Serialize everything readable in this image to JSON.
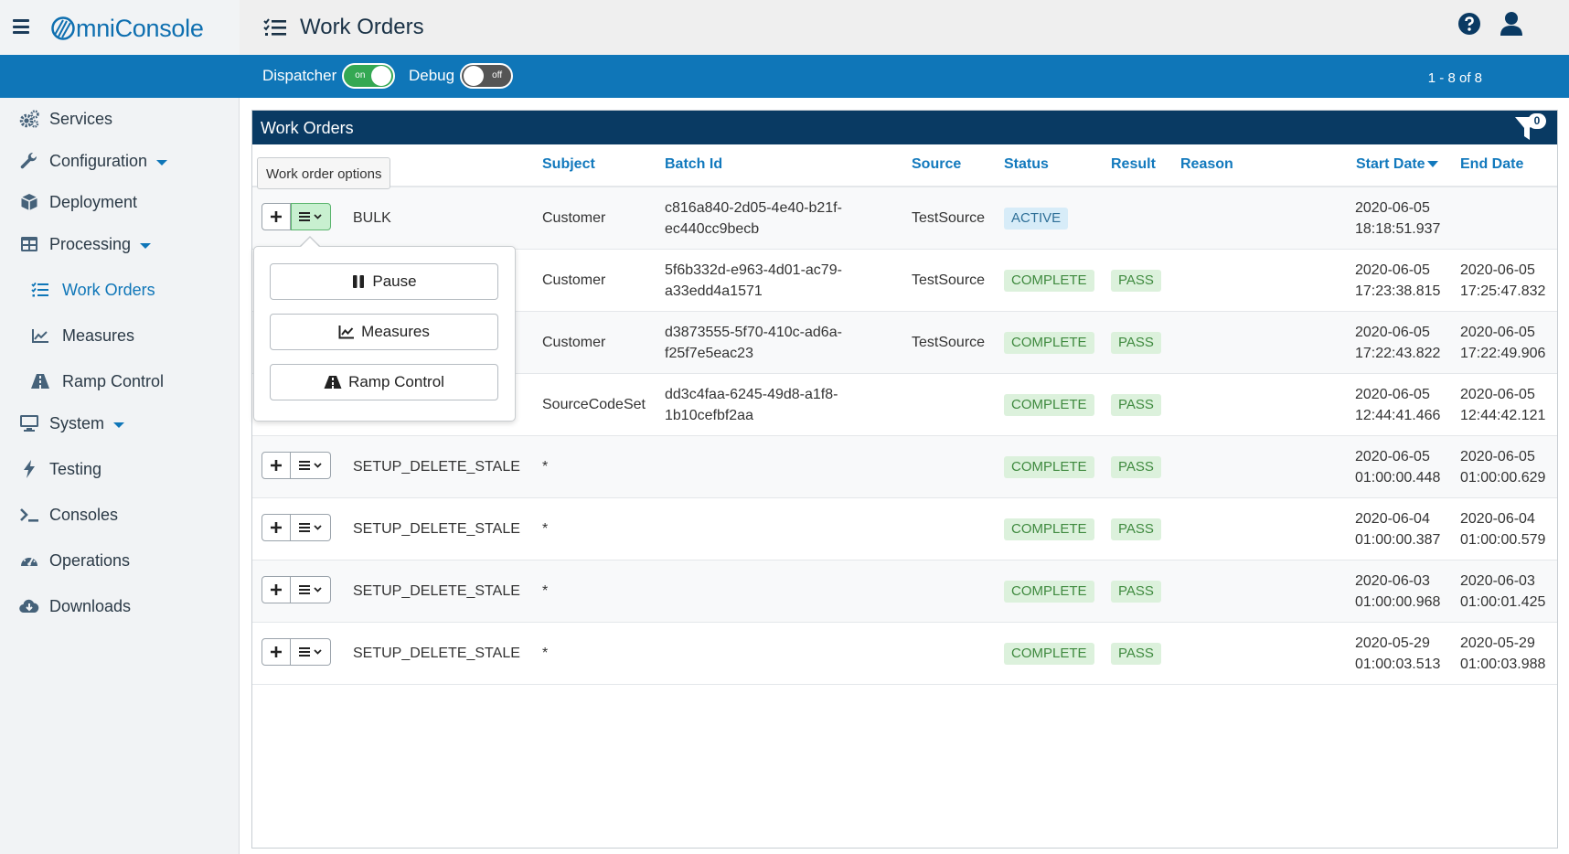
{
  "app": {
    "logo_text": "mniConsole",
    "page_title": "Work Orders"
  },
  "toolbar": {
    "dispatcher_label": "Dispatcher",
    "dispatcher_state": "on",
    "debug_label": "Debug",
    "debug_state": "off",
    "pager_text": "1 - 8 of 8"
  },
  "sidebar": {
    "items": [
      {
        "label": "Services",
        "icon": "gears-icon"
      },
      {
        "label": "Configuration",
        "icon": "wrench-icon"
      },
      {
        "label": "Deployment",
        "icon": "cube-icon"
      },
      {
        "label": "Processing",
        "icon": "table-icon"
      },
      {
        "label": "Work Orders",
        "icon": "list-icon"
      },
      {
        "label": "Measures",
        "icon": "chart-icon"
      },
      {
        "label": "Ramp Control",
        "icon": "road-icon"
      },
      {
        "label": "System",
        "icon": "monitor-icon"
      },
      {
        "label": "Testing",
        "icon": "bolt-icon"
      },
      {
        "label": "Consoles",
        "icon": "terminal-icon"
      },
      {
        "label": "Operations",
        "icon": "gauge-icon"
      },
      {
        "label": "Downloads",
        "icon": "cloud-download-icon"
      }
    ]
  },
  "panel": {
    "title": "Work Orders",
    "filter_count": "0"
  },
  "table": {
    "columns": {
      "subject": "Subject",
      "batch_id": "Batch Id",
      "source": "Source",
      "status": "Status",
      "result": "Result",
      "reason": "Reason",
      "start_date": "Start Date",
      "end_date": "End Date"
    },
    "rows": [
      {
        "type": "BULK",
        "subject": "Customer",
        "batch1": "c816a840-2d05-4e40-b21f-",
        "batch2": "ec440cc9becb",
        "source": "TestSource",
        "status": "ACTIVE",
        "result": "",
        "start1": "2020-06-05",
        "start2": "18:18:51.937",
        "end1": "",
        "end2": ""
      },
      {
        "type": "",
        "subject": "Customer",
        "batch1": "5f6b332d-e963-4d01-ac79-",
        "batch2": "a33edd4a1571",
        "source": "TestSource",
        "status": "COMPLETE",
        "result": "PASS",
        "start1": "2020-06-05",
        "start2": "17:23:38.815",
        "end1": "2020-06-05",
        "end2": "17:25:47.832"
      },
      {
        "type": "",
        "subject": "Customer",
        "batch1": "d3873555-5f70-410c-ad6a-",
        "batch2": "f25f7e5eac23",
        "source": "TestSource",
        "status": "COMPLETE",
        "result": "PASS",
        "start1": "2020-06-05",
        "start2": "17:22:43.822",
        "end1": "2020-06-05",
        "end2": "17:22:49.906"
      },
      {
        "type": "",
        "subject": "SourceCodeSet",
        "batch1": "dd3c4faa-6245-49d8-a1f8-",
        "batch2": "1b10cefbf2aa",
        "source": "",
        "status": "COMPLETE",
        "result": "PASS",
        "start1": "2020-06-05",
        "start2": "12:44:41.466",
        "end1": "2020-06-05",
        "end2": "12:44:42.121"
      },
      {
        "type": "SETUP_DELETE_STALE",
        "subject": "*",
        "batch1": "",
        "batch2": "",
        "source": "",
        "status": "COMPLETE",
        "result": "PASS",
        "start1": "2020-06-05",
        "start2": "01:00:00.448",
        "end1": "2020-06-05",
        "end2": "01:00:00.629"
      },
      {
        "type": "SETUP_DELETE_STALE",
        "subject": "*",
        "batch1": "",
        "batch2": "",
        "source": "",
        "status": "COMPLETE",
        "result": "PASS",
        "start1": "2020-06-04",
        "start2": "01:00:00.387",
        "end1": "2020-06-04",
        "end2": "01:00:00.579"
      },
      {
        "type": "SETUP_DELETE_STALE",
        "subject": "*",
        "batch1": "",
        "batch2": "",
        "source": "",
        "status": "COMPLETE",
        "result": "PASS",
        "start1": "2020-06-03",
        "start2": "01:00:00.968",
        "end1": "2020-06-03",
        "end2": "01:00:01.425"
      },
      {
        "type": "SETUP_DELETE_STALE",
        "subject": "*",
        "batch1": "",
        "batch2": "",
        "source": "",
        "status": "COMPLETE",
        "result": "PASS",
        "start1": "2020-05-29",
        "start2": "01:00:03.513",
        "end1": "2020-05-29",
        "end2": "01:00:03.988"
      }
    ]
  },
  "tooltip": {
    "text": "Work order options"
  },
  "popup": {
    "pause_label": "Pause",
    "measures_label": "Measures",
    "ramp_control_label": "Ramp Control"
  },
  "colors": {
    "brand_blue": "#0f76b8",
    "panel_header": "#093a63",
    "link_blue": "#1279bd",
    "toggle_on": "#34a853",
    "badge_green_bg": "#dcf1dc",
    "badge_blue_bg": "#d7ecf8"
  }
}
